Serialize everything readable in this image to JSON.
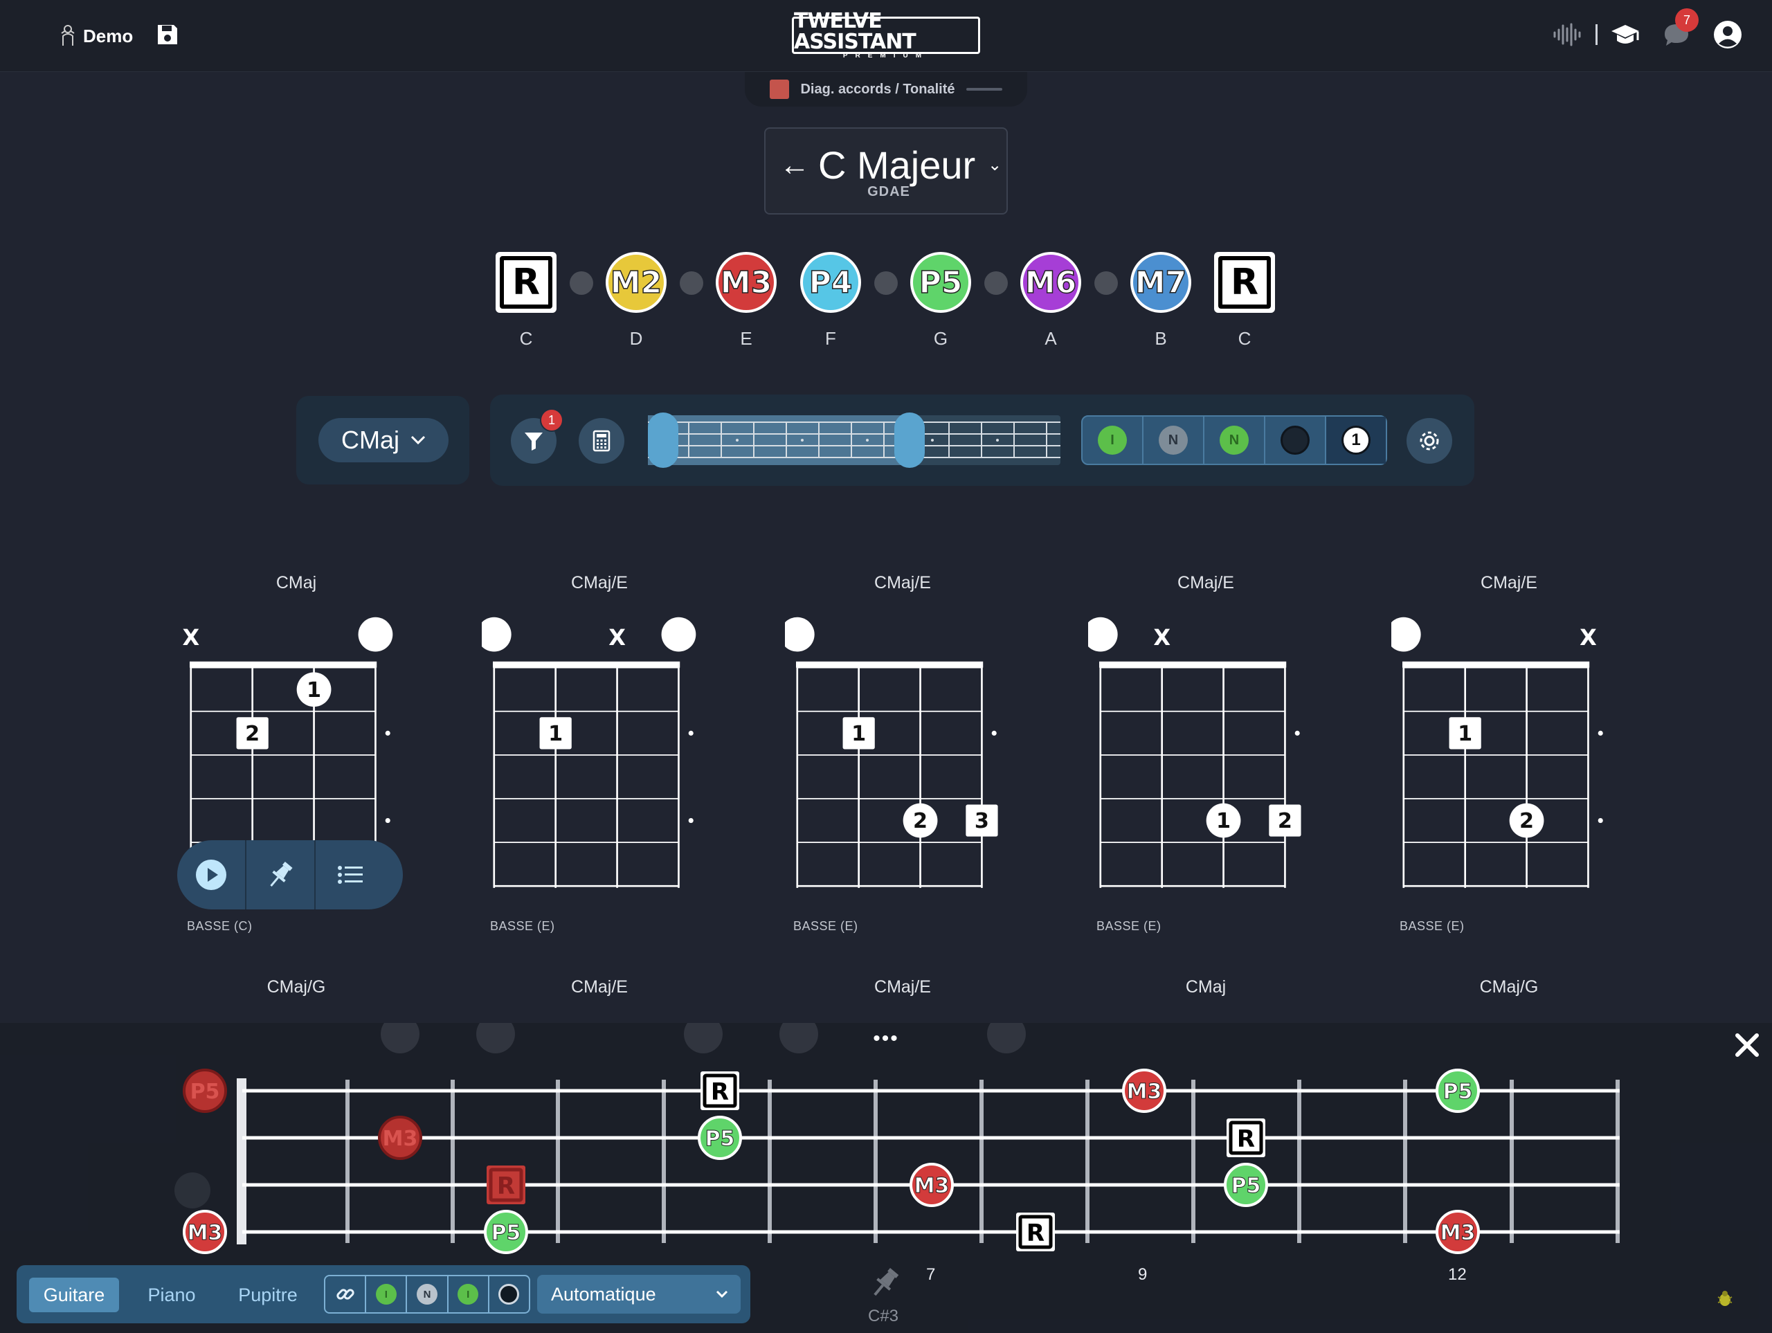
{
  "header": {
    "user_label": "Demo",
    "logo_main": "TWELVE ASSISTANT",
    "logo_sub": "PREMIUM",
    "notification_count": "7"
  },
  "breadcrumb": {
    "label": "Diag. accords / Tonalité"
  },
  "key": {
    "name": "C Majeur",
    "tuning": "GDAE"
  },
  "intervals": [
    {
      "label": "R",
      "note": "C",
      "color": "#ffffff",
      "type": "root"
    },
    {
      "label": "M2",
      "note": "D",
      "color": "#e7c83a",
      "type": "circle"
    },
    {
      "label": "M3",
      "note": "E",
      "color": "#d23b3b",
      "type": "circle"
    },
    {
      "label": "P4",
      "note": "F",
      "color": "#56c6e6",
      "type": "circle"
    },
    {
      "label": "P5",
      "note": "G",
      "color": "#5fd46a",
      "type": "circle"
    },
    {
      "label": "M6",
      "note": "A",
      "color": "#a63ed6",
      "type": "circle"
    },
    {
      "label": "M7",
      "note": "B",
      "color": "#4b8fd0",
      "type": "circle"
    },
    {
      "label": "R",
      "note": "C",
      "color": "#ffffff",
      "type": "root"
    }
  ],
  "toolbar": {
    "chord_select": "CMaj",
    "filter_badge": "1",
    "mode_last_label": "1",
    "mode_letters": [
      "I",
      "N",
      "N"
    ]
  },
  "chords_row1": [
    {
      "title": "CMaj",
      "bass": "BASSE (C)"
    },
    {
      "title": "CMaj/E",
      "bass": "BASSE (E)"
    },
    {
      "title": "CMaj/E",
      "bass": "BASSE (E)"
    },
    {
      "title": "CMaj/E",
      "bass": "BASSE (E)"
    },
    {
      "title": "CMaj/E",
      "bass": "BASSE (E)"
    }
  ],
  "chords_row2": [
    {
      "title": "CMaj/G"
    },
    {
      "title": "CMaj/E"
    },
    {
      "title": "CMaj/E"
    },
    {
      "title": "CMaj"
    },
    {
      "title": "CMaj/G"
    }
  ],
  "diagram_markers": {
    "mute": "X",
    "finger_1": "1",
    "finger_2": "2",
    "finger_3": "3"
  },
  "fretboard": {
    "fret_labels": [
      "7",
      "9",
      "12"
    ],
    "notes": [
      "R",
      "P5",
      "M3"
    ],
    "ghost_label": "C#3"
  },
  "bottom": {
    "instruments": [
      "Guitare",
      "Piano",
      "Pupitre"
    ],
    "auto_select": "Automatique",
    "mode_letters": [
      "I",
      "N",
      "I"
    ]
  }
}
